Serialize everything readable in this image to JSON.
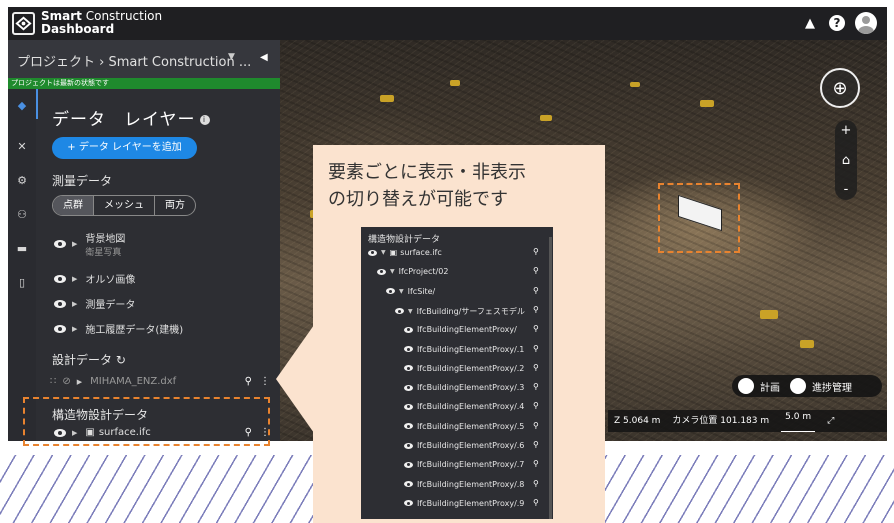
{
  "app": {
    "brand_line1_bold": "Smart",
    "brand_line1_rest": " Construction",
    "brand_line2": "Dashboard"
  },
  "breadcrumb": "プロジェクト › Smart Construction ...",
  "status": "プロジェクトは最新の状態です",
  "layers": {
    "title": "データ　レイヤー",
    "add_button": "+ データ レイヤーを追加",
    "survey_label": "測量データ",
    "segments": [
      "点群",
      "メッシュ",
      "両方"
    ],
    "rows": [
      {
        "label": "背景地図",
        "sub": "衛星写真"
      },
      {
        "label": "オルソ画像"
      },
      {
        "label": "測量データ"
      },
      {
        "label": "施工履歴データ(建機)"
      }
    ],
    "design_label": "設計データ",
    "design_file": "MIHAMA_ENZ.dxf",
    "struct_label": "構造物設計データ",
    "struct_file": "surface.ifc"
  },
  "viewport": {
    "toggle_plan": "計画",
    "toggle_progress": "進捗管理",
    "z_value": "Z 5.064 m",
    "camera_pos": "カメラ位置 101.183 m",
    "scale": "5.0 m"
  },
  "callout": {
    "line1": "要素ごとに表示・非表示",
    "line2": "の切り替えが可能です"
  },
  "tree": {
    "title": "構造物設計データ",
    "items": [
      {
        "label": "surface.ifc",
        "indent": 0
      },
      {
        "label": "IfcProject/02",
        "indent": 1
      },
      {
        "label": "IfcSite/",
        "indent": 2
      },
      {
        "label": "IfcBuilding/サーフェスモデル",
        "indent": 3
      },
      {
        "label": "IfcBuildingElementProxy/",
        "indent": 4
      },
      {
        "label": "IfcBuildingElementProxy/.1",
        "indent": 4
      },
      {
        "label": "IfcBuildingElementProxy/.2",
        "indent": 4
      },
      {
        "label": "IfcBuildingElementProxy/.3",
        "indent": 4
      },
      {
        "label": "IfcBuildingElementProxy/.4",
        "indent": 4
      },
      {
        "label": "IfcBuildingElementProxy/.5",
        "indent": 4
      },
      {
        "label": "IfcBuildingElementProxy/.6",
        "indent": 4
      },
      {
        "label": "IfcBuildingElementProxy/.7",
        "indent": 4
      },
      {
        "label": "IfcBuildingElementProxy/.8",
        "indent": 4
      },
      {
        "label": "IfcBuildingElementProxy/.9",
        "indent": 4
      }
    ]
  }
}
